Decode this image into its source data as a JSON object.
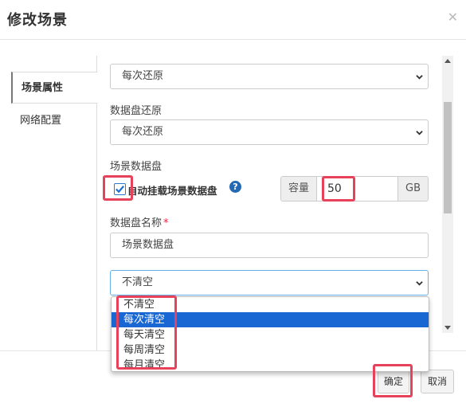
{
  "dialog": {
    "title": "修改场景",
    "close_icon": "close-icon"
  },
  "tabs": [
    {
      "label": "场景属性",
      "active": true
    },
    {
      "label": "网络配置",
      "active": false
    }
  ],
  "form": {
    "top_select_value": "每次还原",
    "data_disk_restore_label": "数据盘还原",
    "data_disk_restore_value": "每次还原",
    "scene_data_disk_label": "场景数据盘",
    "auto_mount_label": "自动挂载场景数据盘",
    "auto_mount_checked": true,
    "help_glyph": "?",
    "capacity_label": "容量",
    "capacity_value": "50",
    "capacity_unit": "GB",
    "disk_name_label": "数据盘名称",
    "required_mark": "*",
    "disk_name_value": "场景数据盘",
    "clear_select_value": "不清空"
  },
  "dropdown": {
    "options": [
      "不清空",
      "每次清空",
      "每天清空",
      "每周清空",
      "每月清空"
    ],
    "highlighted_index": 1
  },
  "footer": {
    "confirm_label": "确定",
    "cancel_label": "取消"
  },
  "colors": {
    "highlight": "#e8415a",
    "accent": "#1967d2",
    "help_icon": "#2469b2"
  }
}
